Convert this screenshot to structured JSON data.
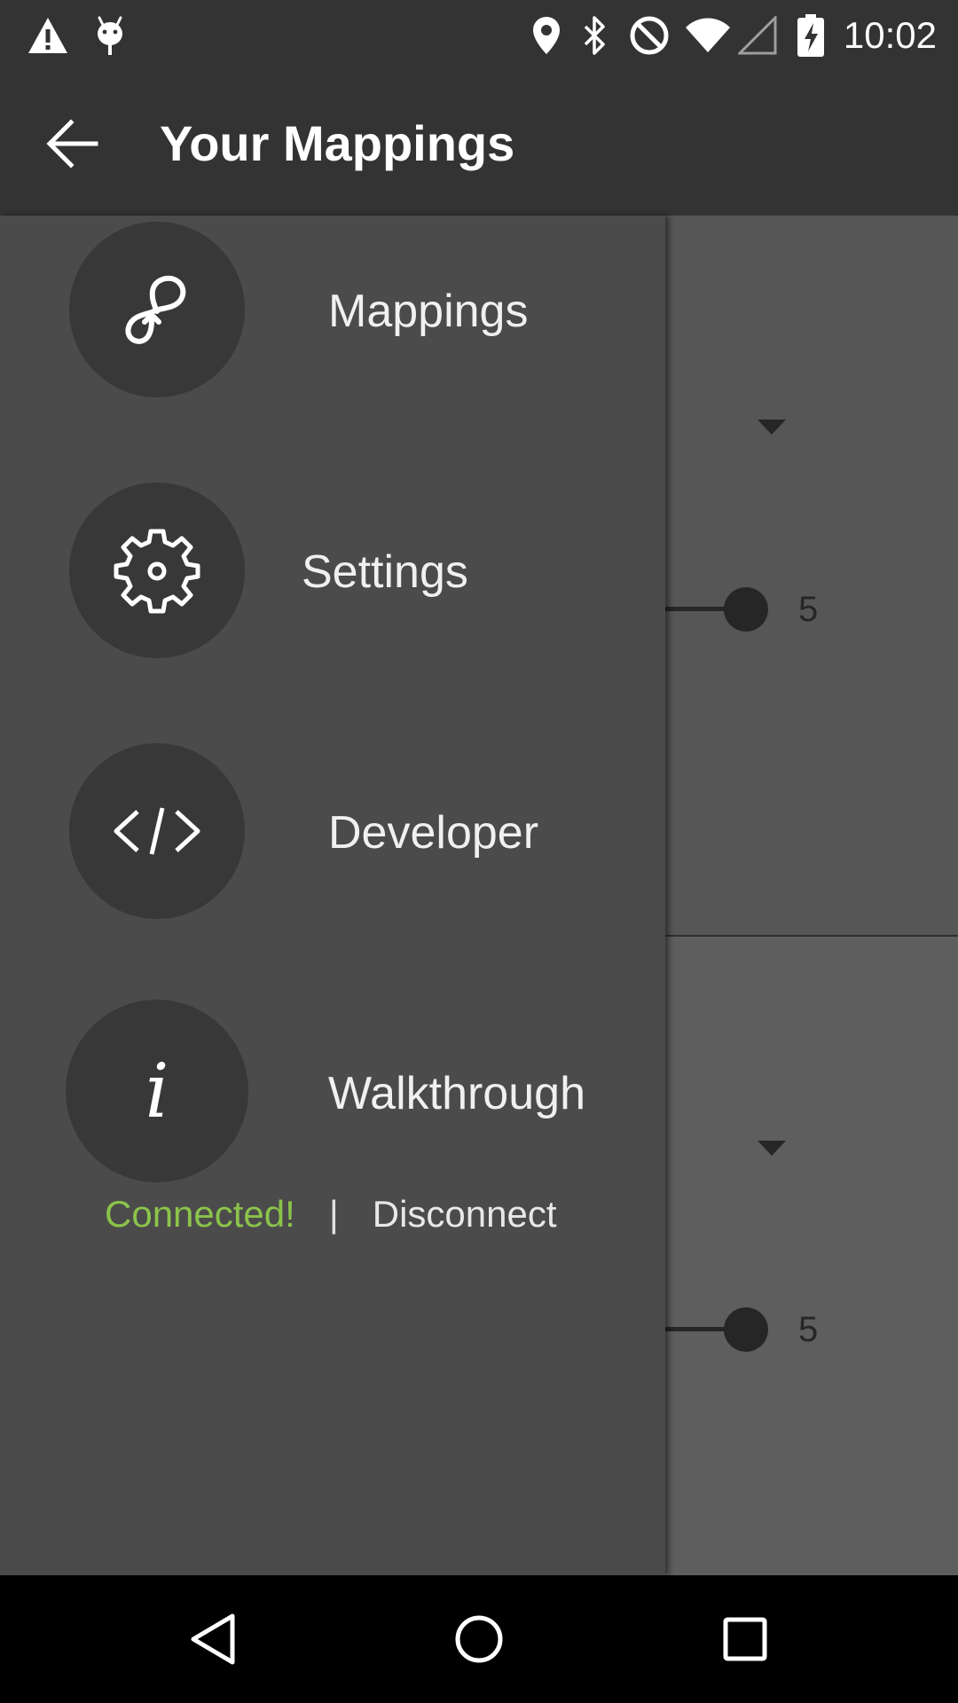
{
  "status_bar": {
    "time": "10:02",
    "left_icons": [
      "warning-icon",
      "android-debug-icon"
    ],
    "right_icons": [
      "location-icon",
      "bluetooth-icon",
      "do-not-disturb-icon",
      "wifi-icon",
      "cell-signal-icon",
      "battery-charging-icon"
    ]
  },
  "app_bar": {
    "title": "Your Mappings",
    "back_icon": "arrow-back-icon"
  },
  "drawer": {
    "items": [
      {
        "label": "Mappings",
        "icon": "link-loop-icon"
      },
      {
        "label": "Settings",
        "icon": "gear-icon"
      },
      {
        "label": "Developer",
        "icon": "code-icon"
      },
      {
        "label": "Walkthrough",
        "icon": "info-icon"
      }
    ],
    "connection": {
      "status": "Connected!",
      "separator": "|",
      "action": "Disconnect"
    }
  },
  "background_cards": [
    {
      "slider_value": "5"
    },
    {
      "slider_value": "5"
    }
  ],
  "colors": {
    "status_connected": "#8bc34a",
    "drawer_background": "#4b4b4b",
    "app_bar": "#333333"
  },
  "nav_bar": {
    "buttons": [
      "back-triangle-icon",
      "home-circle-icon",
      "recents-square-icon"
    ]
  }
}
